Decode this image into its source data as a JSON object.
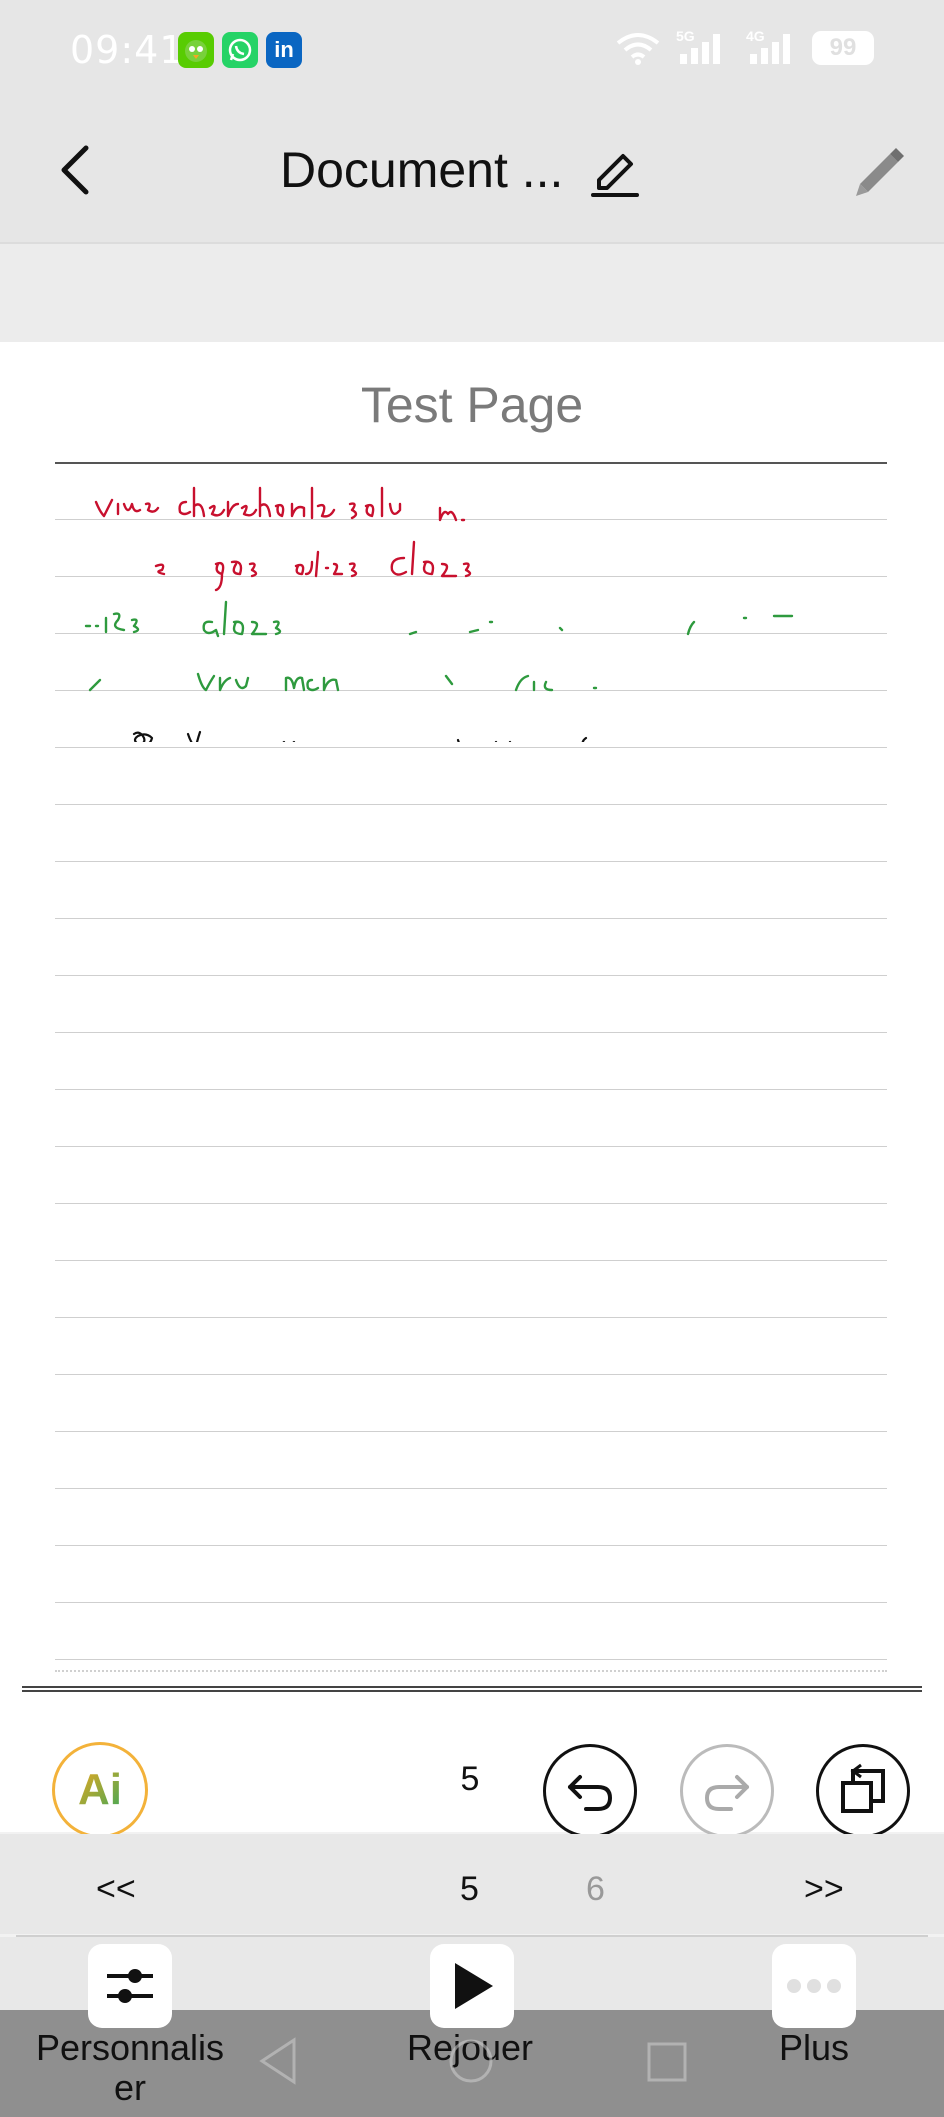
{
  "status_bar": {
    "time": "09:41",
    "apps": [
      "duolingo-icon",
      "whatsapp-icon",
      "linkedin-icon"
    ],
    "linkedin_label": "in",
    "network_1": "5G",
    "network_2": "4G",
    "battery": "99"
  },
  "header": {
    "title": "Document ..."
  },
  "page": {
    "title": "Test Page",
    "ink_colors": {
      "red": "#c8102e",
      "green": "#2e9a3e",
      "black": "#111111",
      "orange": "#f4a623"
    }
  },
  "toolbar": {
    "ai_label": "Ai",
    "page_count": "5"
  },
  "pager": {
    "prev": "<<",
    "current": "5",
    "next_page": "6",
    "next": ">>"
  },
  "bottom_bar": {
    "customize_label": "Personnalis\ner",
    "replay_label": "Rejouer",
    "more_label": "Plus"
  }
}
